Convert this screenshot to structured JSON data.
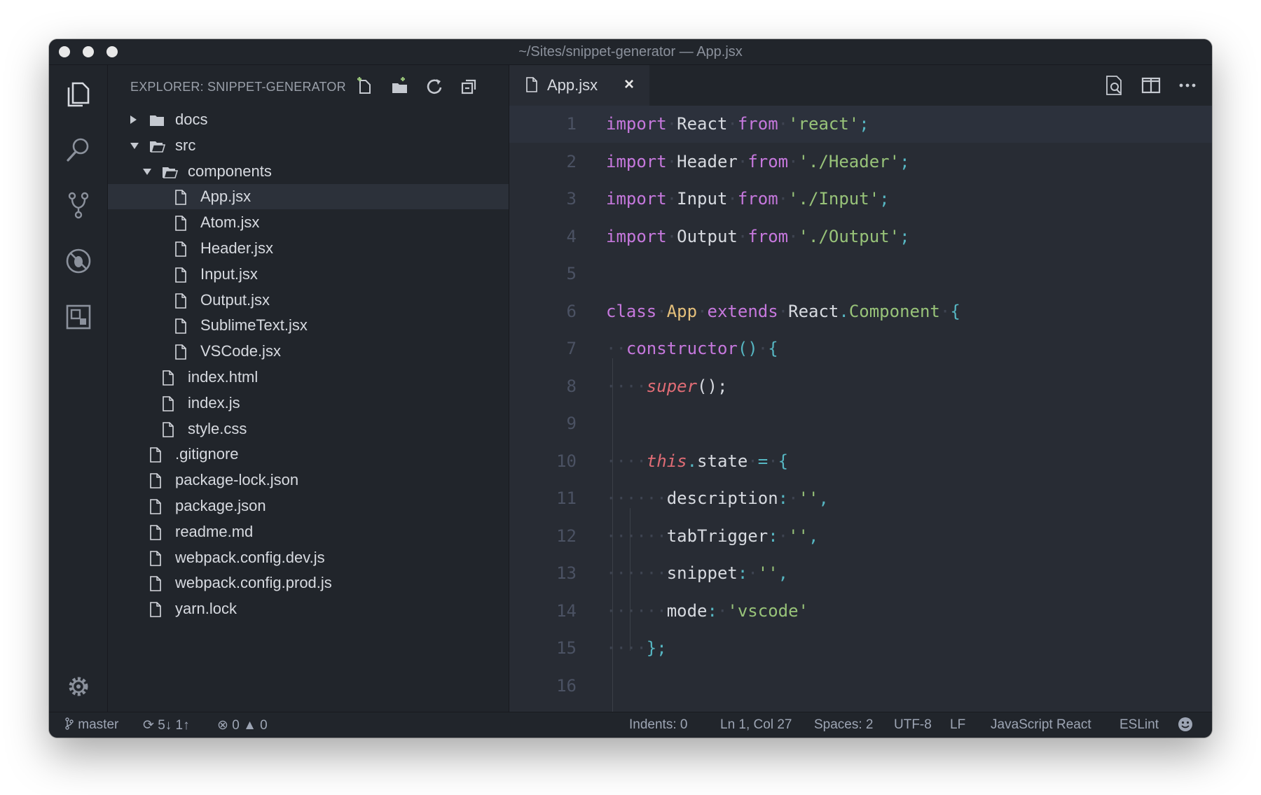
{
  "window": {
    "title": "~/Sites/snippet-generator — App.jsx"
  },
  "activity_bar": {
    "items": [
      {
        "name": "explorer-icon"
      },
      {
        "name": "search-icon"
      },
      {
        "name": "source-control-icon"
      },
      {
        "name": "debug-icon"
      },
      {
        "name": "extensions-icon"
      }
    ],
    "settings_icon": "gear-icon"
  },
  "explorer": {
    "title": "EXPLORER: SNIPPET-GENERATOR",
    "actions": [
      "new-file-icon",
      "new-folder-icon",
      "refresh-icon",
      "collapse-all-icon"
    ],
    "tree": [
      {
        "label": "docs",
        "type": "folder",
        "depth": 0,
        "expanded": false
      },
      {
        "label": "src",
        "type": "folder",
        "depth": 0,
        "expanded": true
      },
      {
        "label": "components",
        "type": "folder",
        "depth": 1,
        "expanded": true
      },
      {
        "label": "App.jsx",
        "type": "file",
        "depth": 2,
        "selected": true
      },
      {
        "label": "Atom.jsx",
        "type": "file",
        "depth": 2
      },
      {
        "label": "Header.jsx",
        "type": "file",
        "depth": 2
      },
      {
        "label": "Input.jsx",
        "type": "file",
        "depth": 2
      },
      {
        "label": "Output.jsx",
        "type": "file",
        "depth": 2
      },
      {
        "label": "SublimeText.jsx",
        "type": "file",
        "depth": 2
      },
      {
        "label": "VSCode.jsx",
        "type": "file",
        "depth": 2
      },
      {
        "label": "index.html",
        "type": "file",
        "depth": 1
      },
      {
        "label": "index.js",
        "type": "file",
        "depth": 1
      },
      {
        "label": "style.css",
        "type": "file",
        "depth": 1
      },
      {
        "label": ".gitignore",
        "type": "file",
        "depth": 0
      },
      {
        "label": "package-lock.json",
        "type": "file",
        "depth": 0
      },
      {
        "label": "package.json",
        "type": "file",
        "depth": 0
      },
      {
        "label": "readme.md",
        "type": "file",
        "depth": 0
      },
      {
        "label": "webpack.config.dev.js",
        "type": "file",
        "depth": 0
      },
      {
        "label": "webpack.config.prod.js",
        "type": "file",
        "depth": 0
      },
      {
        "label": "yarn.lock",
        "type": "file",
        "depth": 0
      }
    ]
  },
  "editor": {
    "tab": {
      "label": "App.jsx",
      "close": "×"
    },
    "actions": [
      "find-icon",
      "split-editor-icon",
      "more-icon"
    ],
    "current_line": 1,
    "lines": [
      {
        "n": "1",
        "tokens": [
          [
            "kw",
            "import"
          ],
          [
            "ws",
            "·"
          ],
          [
            "plain",
            "React"
          ],
          [
            "ws",
            "·"
          ],
          [
            "kw",
            "from"
          ],
          [
            "ws",
            "·"
          ],
          [
            "str",
            "'react'"
          ],
          [
            "punc",
            ";"
          ]
        ]
      },
      {
        "n": "2",
        "tokens": [
          [
            "kw",
            "import"
          ],
          [
            "ws",
            "·"
          ],
          [
            "plain",
            "Header"
          ],
          [
            "ws",
            "·"
          ],
          [
            "kw",
            "from"
          ],
          [
            "ws",
            "·"
          ],
          [
            "str",
            "'./Header'"
          ],
          [
            "punc",
            ";"
          ]
        ]
      },
      {
        "n": "3",
        "tokens": [
          [
            "kw",
            "import"
          ],
          [
            "ws",
            "·"
          ],
          [
            "plain",
            "Input"
          ],
          [
            "ws",
            "·"
          ],
          [
            "kw",
            "from"
          ],
          [
            "ws",
            "·"
          ],
          [
            "str",
            "'./Input'"
          ],
          [
            "punc",
            ";"
          ]
        ]
      },
      {
        "n": "4",
        "tokens": [
          [
            "kw",
            "import"
          ],
          [
            "ws",
            "·"
          ],
          [
            "plain",
            "Output"
          ],
          [
            "ws",
            "·"
          ],
          [
            "kw",
            "from"
          ],
          [
            "ws",
            "·"
          ],
          [
            "str",
            "'./Output'"
          ],
          [
            "punc",
            ";"
          ]
        ]
      },
      {
        "n": "5",
        "tokens": []
      },
      {
        "n": "6",
        "tokens": [
          [
            "kw",
            "class"
          ],
          [
            "ws",
            "·"
          ],
          [
            "cls",
            "App"
          ],
          [
            "ws",
            "·"
          ],
          [
            "kw",
            "extends"
          ],
          [
            "ws",
            "·"
          ],
          [
            "plain",
            "React"
          ],
          [
            "punc",
            "."
          ],
          [
            "prop",
            "Component"
          ],
          [
            "ws",
            "·"
          ],
          [
            "punc",
            "{"
          ]
        ]
      },
      {
        "n": "7",
        "tokens": [
          [
            "ws",
            "··"
          ],
          [
            "fn",
            "constructor"
          ],
          [
            "punc",
            "()"
          ],
          [
            "ws",
            "·"
          ],
          [
            "punc",
            "{"
          ]
        ]
      },
      {
        "n": "8",
        "tokens": [
          [
            "ws",
            "····"
          ],
          [
            "this",
            "super"
          ],
          [
            "plain",
            "();"
          ]
        ]
      },
      {
        "n": "9",
        "tokens": []
      },
      {
        "n": "10",
        "tokens": [
          [
            "ws",
            "····"
          ],
          [
            "this",
            "this"
          ],
          [
            "punc",
            "."
          ],
          [
            "plain",
            "state"
          ],
          [
            "ws",
            "·"
          ],
          [
            "punc",
            "="
          ],
          [
            "ws",
            "·"
          ],
          [
            "punc",
            "{"
          ]
        ]
      },
      {
        "n": "11",
        "tokens": [
          [
            "ws",
            "······"
          ],
          [
            "plain",
            "description"
          ],
          [
            "punc",
            ":"
          ],
          [
            "ws",
            "·"
          ],
          [
            "str",
            "''"
          ],
          [
            "punc",
            ","
          ]
        ]
      },
      {
        "n": "12",
        "tokens": [
          [
            "ws",
            "······"
          ],
          [
            "plain",
            "tabTrigger"
          ],
          [
            "punc",
            ":"
          ],
          [
            "ws",
            "·"
          ],
          [
            "str",
            "''"
          ],
          [
            "punc",
            ","
          ]
        ]
      },
      {
        "n": "13",
        "tokens": [
          [
            "ws",
            "······"
          ],
          [
            "plain",
            "snippet"
          ],
          [
            "punc",
            ":"
          ],
          [
            "ws",
            "·"
          ],
          [
            "str",
            "''"
          ],
          [
            "punc",
            ","
          ]
        ]
      },
      {
        "n": "14",
        "tokens": [
          [
            "ws",
            "······"
          ],
          [
            "plain",
            "mode"
          ],
          [
            "punc",
            ":"
          ],
          [
            "ws",
            "·"
          ],
          [
            "str",
            "'vscode'"
          ]
        ]
      },
      {
        "n": "15",
        "tokens": [
          [
            "ws",
            "····"
          ],
          [
            "punc",
            "};"
          ]
        ]
      },
      {
        "n": "16",
        "tokens": []
      }
    ]
  },
  "status_bar": {
    "branch": "master",
    "sync": "5↓ 1↑",
    "errors": "0",
    "warnings": "0",
    "indents": "Indents: 0",
    "position": "Ln 1, Col 27",
    "spaces": "Spaces: 2",
    "encoding": "UTF-8",
    "eol": "LF",
    "language": "JavaScript React",
    "linter": "ESLint",
    "feedback_icon": "smiley-icon"
  },
  "colors": {
    "keyword": "#c678dd",
    "string": "#98c379",
    "class": "#e5c07b",
    "this": "#e06c75",
    "punctuation": "#56b6c2",
    "background": "#282c34",
    "sidebar": "#21252b"
  }
}
